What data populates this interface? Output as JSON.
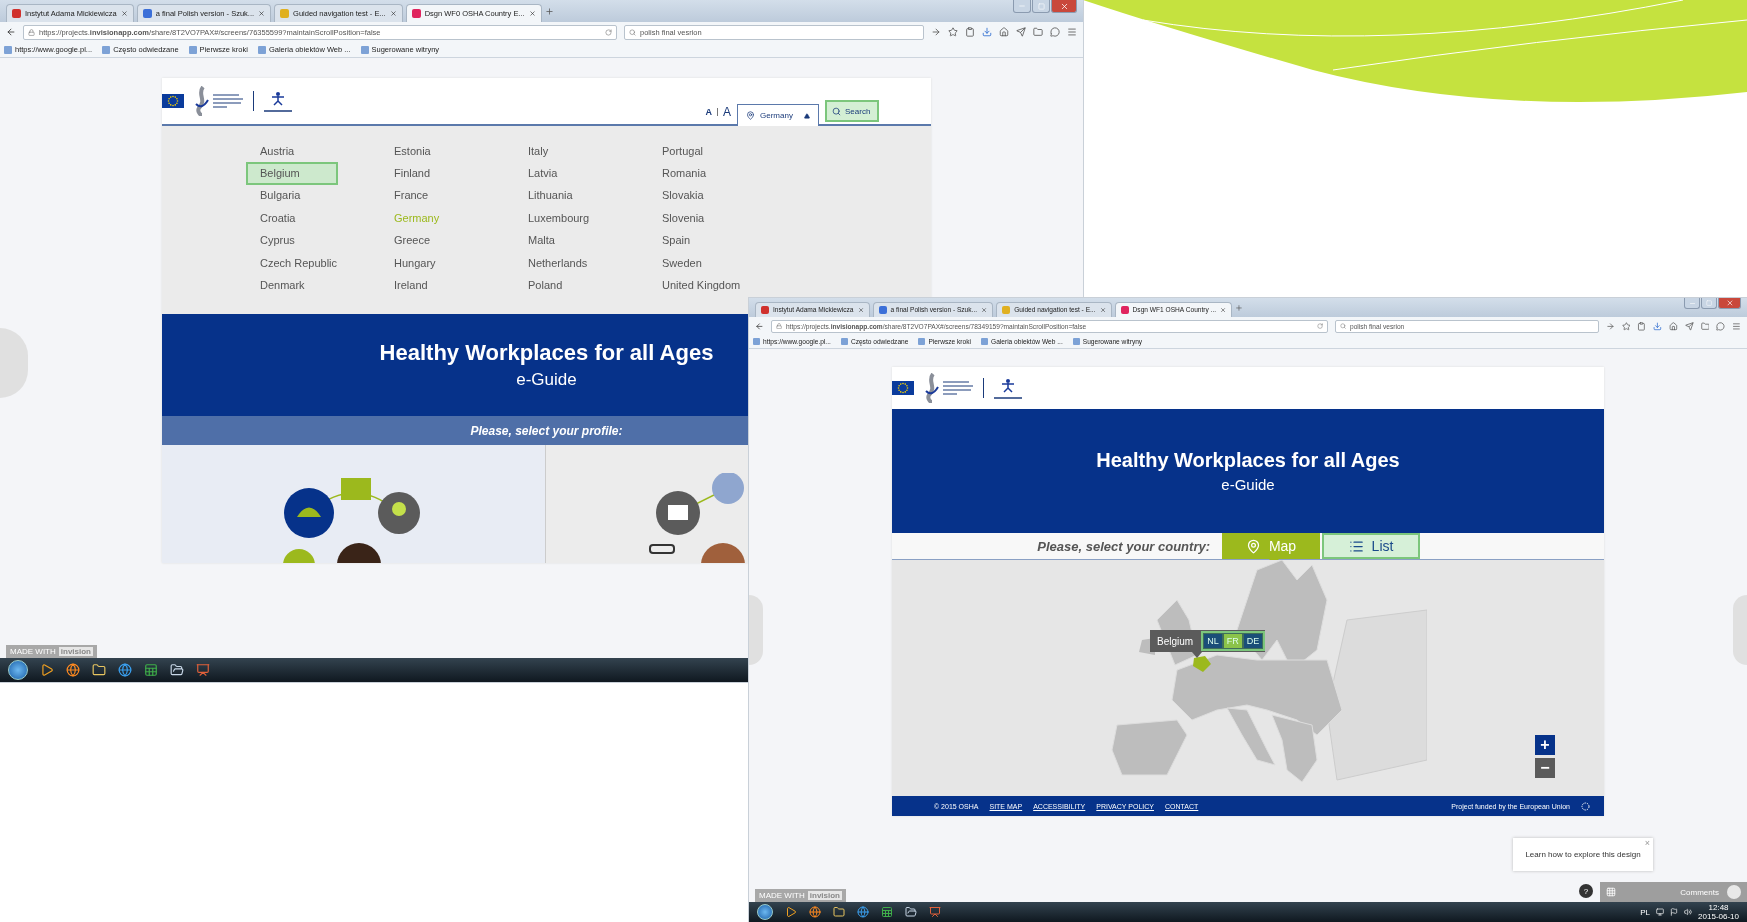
{
  "first_window": {
    "browser": {
      "tabs": [
        {
          "label": "Instytut Adama Mickiewicza",
          "selected": false,
          "color": "#d0312d"
        },
        {
          "label": "a final Polish version - Szuk...",
          "selected": false,
          "color": "#3b6fd8"
        },
        {
          "label": "Guided navigation test - E...",
          "selected": false,
          "color": "#e0b020"
        },
        {
          "label": "Dsgn WF0 OSHA Country E...",
          "selected": true,
          "color": "#e0245e"
        }
      ],
      "url": "https://projects.**invisionapp.com**/share/8T2VO7PAX#/screens/76355599?maintainScrollPosition=false",
      "search": "polish  final vesrion",
      "bookmarks": [
        "https://www.google.pl...",
        "Często odwiedzane",
        "Pierwsze kroki",
        "Galeria obiektów Web ...",
        "Sugerowane witryny"
      ]
    },
    "page": {
      "font_size_switch": [
        {
          "label": "A"
        },
        {
          "label": "A"
        }
      ],
      "country_button": "Germany",
      "search_button": "Search",
      "country_columns": [
        [
          {
            "name": "Austria",
            "selected": false,
            "focused": false
          },
          {
            "name": "Belgium",
            "selected": false,
            "focused": true
          },
          {
            "name": "Bulgaria",
            "selected": false,
            "focused": false
          },
          {
            "name": "Croatia",
            "selected": false,
            "focused": false
          },
          {
            "name": "Cyprus",
            "selected": false,
            "focused": false
          },
          {
            "name": "Czech Republic",
            "selected": false,
            "focused": false
          },
          {
            "name": "Denmark",
            "selected": false,
            "focused": false
          }
        ],
        [
          {
            "name": "Estonia",
            "selected": false,
            "focused": false
          },
          {
            "name": "Finland",
            "selected": false,
            "focused": false
          },
          {
            "name": "France",
            "selected": false,
            "focused": false
          },
          {
            "name": "Germany",
            "selected": true,
            "focused": false
          },
          {
            "name": "Greece",
            "selected": false,
            "focused": false
          },
          {
            "name": "Hungary",
            "selected": false,
            "focused": false
          },
          {
            "name": "Ireland",
            "selected": false,
            "focused": false
          }
        ],
        [
          {
            "name": "Italy",
            "selected": false,
            "focused": false
          },
          {
            "name": "Latvia",
            "selected": false,
            "focused": false
          },
          {
            "name": "Lithuania",
            "selected": false,
            "focused": false
          },
          {
            "name": "Luxembourg",
            "selected": false,
            "focused": false
          },
          {
            "name": "Malta",
            "selected": false,
            "focused": false
          },
          {
            "name": "Netherlands",
            "selected": false,
            "focused": false
          },
          {
            "name": "Poland",
            "selected": false,
            "focused": false
          }
        ],
        [
          {
            "name": "Portugal",
            "selected": false,
            "focused": false
          },
          {
            "name": "Romania",
            "selected": false,
            "focused": false
          },
          {
            "name": "Slovakia",
            "selected": false,
            "focused": false
          },
          {
            "name": "Slovenia",
            "selected": false,
            "focused": false
          },
          {
            "name": "Spain",
            "selected": false,
            "focused": false
          },
          {
            "name": "Sweden",
            "selected": false,
            "focused": false
          },
          {
            "name": "United Kingdom",
            "selected": false,
            "focused": false
          }
        ]
      ],
      "banner": {
        "title": "Healthy Workplaces for all Ages",
        "subtitle": "e-Guide"
      },
      "profile_prompt": "Please, select your profile:"
    },
    "made_with": {
      "prefix": "MADE WITH",
      "brand": "invision"
    }
  },
  "second_window": {
    "browser": {
      "tabs": [
        {
          "label": "Instytut Adama Mickiewicza",
          "selected": false,
          "color": "#d0312d"
        },
        {
          "label": "a final Polish version - Szuk...",
          "selected": false,
          "color": "#3b6fd8"
        },
        {
          "label": "Guided navigation test - E...",
          "selected": false,
          "color": "#e0b020"
        },
        {
          "label": "Dsgn WF1 OSHA Country ...",
          "selected": true,
          "color": "#e0245e"
        }
      ],
      "url": "https://projects.**invisionapp.com**/share/8T2VO7PAX#/screens/78349159?maintainScrollPosition=false",
      "search": "polish  final vesrion",
      "bookmarks": [
        "https://www.google.pl...",
        "Często odwiedzane",
        "Pierwsze kroki",
        "Galeria obiektów Web ...",
        "Sugerowane witryny"
      ]
    },
    "page": {
      "banner": {
        "title": "Healthy Workplaces for all Ages",
        "subtitle": "e-Guide"
      },
      "country_prompt": "Please, select your country:",
      "views": [
        {
          "kind": "map",
          "label": "Map",
          "selected": true
        },
        {
          "kind": "list",
          "label": "List",
          "selected": false
        }
      ],
      "map_tooltip": {
        "country": "Belgium",
        "languages": [
          {
            "label": "NL",
            "selected": false
          },
          {
            "label": "FR",
            "selected": true
          },
          {
            "label": "DE",
            "selected": false
          }
        ]
      },
      "zoom_in": "+",
      "zoom_out": "−",
      "footer": {
        "copyright": "© 2015 OSHA",
        "links": [
          "SITE MAP",
          "ACCESSIBILITY",
          "PRIVACY POLICY",
          "CONTACT"
        ],
        "funding": "Project funded by the European Union"
      }
    },
    "made_with": {
      "prefix": "MADE WITH",
      "brand": "invision"
    },
    "hint": {
      "text": "Learn how to explore this design",
      "close": "×"
    },
    "help": "?",
    "comments": "Comments",
    "taskbar": {
      "language": "PL",
      "time": "12:48",
      "date": "2015-06-10"
    }
  }
}
